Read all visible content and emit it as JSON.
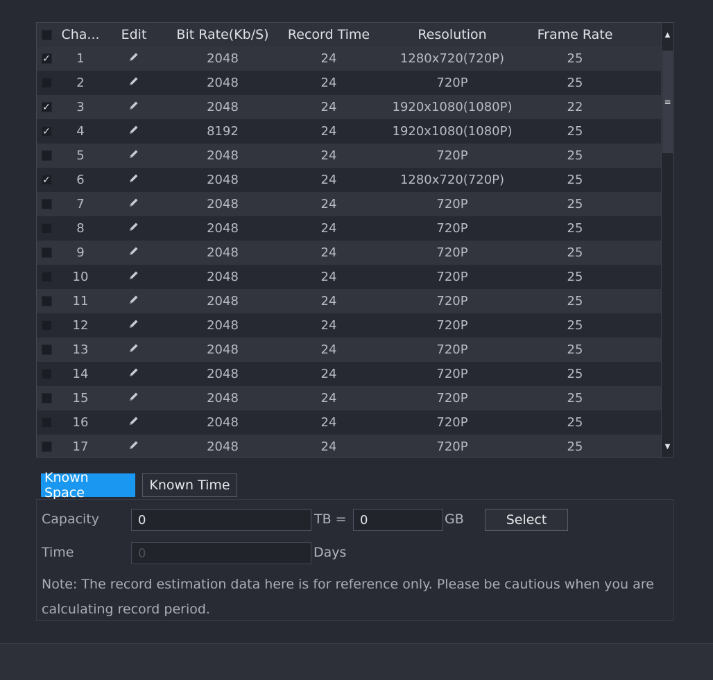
{
  "table": {
    "headers": {
      "channel": "Cha...",
      "edit": "Edit",
      "bit_rate": "Bit Rate(Kb/S)",
      "record_time": "Record Time",
      "resolution": "Resolution",
      "frame_rate": "Frame Rate"
    },
    "select_all_checked": false,
    "rows": [
      {
        "checked": true,
        "channel": "1",
        "bit_rate": "2048",
        "record_time": "24",
        "resolution": "1280x720(720P)",
        "frame_rate": "25"
      },
      {
        "checked": false,
        "channel": "2",
        "bit_rate": "2048",
        "record_time": "24",
        "resolution": "720P",
        "frame_rate": "25"
      },
      {
        "checked": true,
        "channel": "3",
        "bit_rate": "2048",
        "record_time": "24",
        "resolution": "1920x1080(1080P)",
        "frame_rate": "22"
      },
      {
        "checked": true,
        "channel": "4",
        "bit_rate": "8192",
        "record_time": "24",
        "resolution": "1920x1080(1080P)",
        "frame_rate": "25"
      },
      {
        "checked": false,
        "channel": "5",
        "bit_rate": "2048",
        "record_time": "24",
        "resolution": "720P",
        "frame_rate": "25"
      },
      {
        "checked": true,
        "channel": "6",
        "bit_rate": "2048",
        "record_time": "24",
        "resolution": "1280x720(720P)",
        "frame_rate": "25"
      },
      {
        "checked": false,
        "channel": "7",
        "bit_rate": "2048",
        "record_time": "24",
        "resolution": "720P",
        "frame_rate": "25"
      },
      {
        "checked": false,
        "channel": "8",
        "bit_rate": "2048",
        "record_time": "24",
        "resolution": "720P",
        "frame_rate": "25"
      },
      {
        "checked": false,
        "channel": "9",
        "bit_rate": "2048",
        "record_time": "24",
        "resolution": "720P",
        "frame_rate": "25"
      },
      {
        "checked": false,
        "channel": "10",
        "bit_rate": "2048",
        "record_time": "24",
        "resolution": "720P",
        "frame_rate": "25"
      },
      {
        "checked": false,
        "channel": "11",
        "bit_rate": "2048",
        "record_time": "24",
        "resolution": "720P",
        "frame_rate": "25"
      },
      {
        "checked": false,
        "channel": "12",
        "bit_rate": "2048",
        "record_time": "24",
        "resolution": "720P",
        "frame_rate": "25"
      },
      {
        "checked": false,
        "channel": "13",
        "bit_rate": "2048",
        "record_time": "24",
        "resolution": "720P",
        "frame_rate": "25"
      },
      {
        "checked": false,
        "channel": "14",
        "bit_rate": "2048",
        "record_time": "24",
        "resolution": "720P",
        "frame_rate": "25"
      },
      {
        "checked": false,
        "channel": "15",
        "bit_rate": "2048",
        "record_time": "24",
        "resolution": "720P",
        "frame_rate": "25"
      },
      {
        "checked": false,
        "channel": "16",
        "bit_rate": "2048",
        "record_time": "24",
        "resolution": "720P",
        "frame_rate": "25"
      },
      {
        "checked": false,
        "channel": "17",
        "bit_rate": "2048",
        "record_time": "24",
        "resolution": "720P",
        "frame_rate": "25"
      }
    ],
    "edit_icon": "pencil-icon"
  },
  "tabs": {
    "known_space": "Known Space",
    "known_time": "Known Time",
    "active": "known_space"
  },
  "form": {
    "capacity_label": "Capacity",
    "capacity_value": "0",
    "tb_label": "TB =",
    "gb_value": "0",
    "gb_label": "GB",
    "select_label": "Select",
    "time_label": "Time",
    "time_value": "0",
    "days_label": "Days",
    "note": "Note: The record estimation data here is for reference only. Please be cautious when you are calculating record period."
  },
  "colors": {
    "accent": "#1a97f0",
    "background": "#282a33"
  }
}
